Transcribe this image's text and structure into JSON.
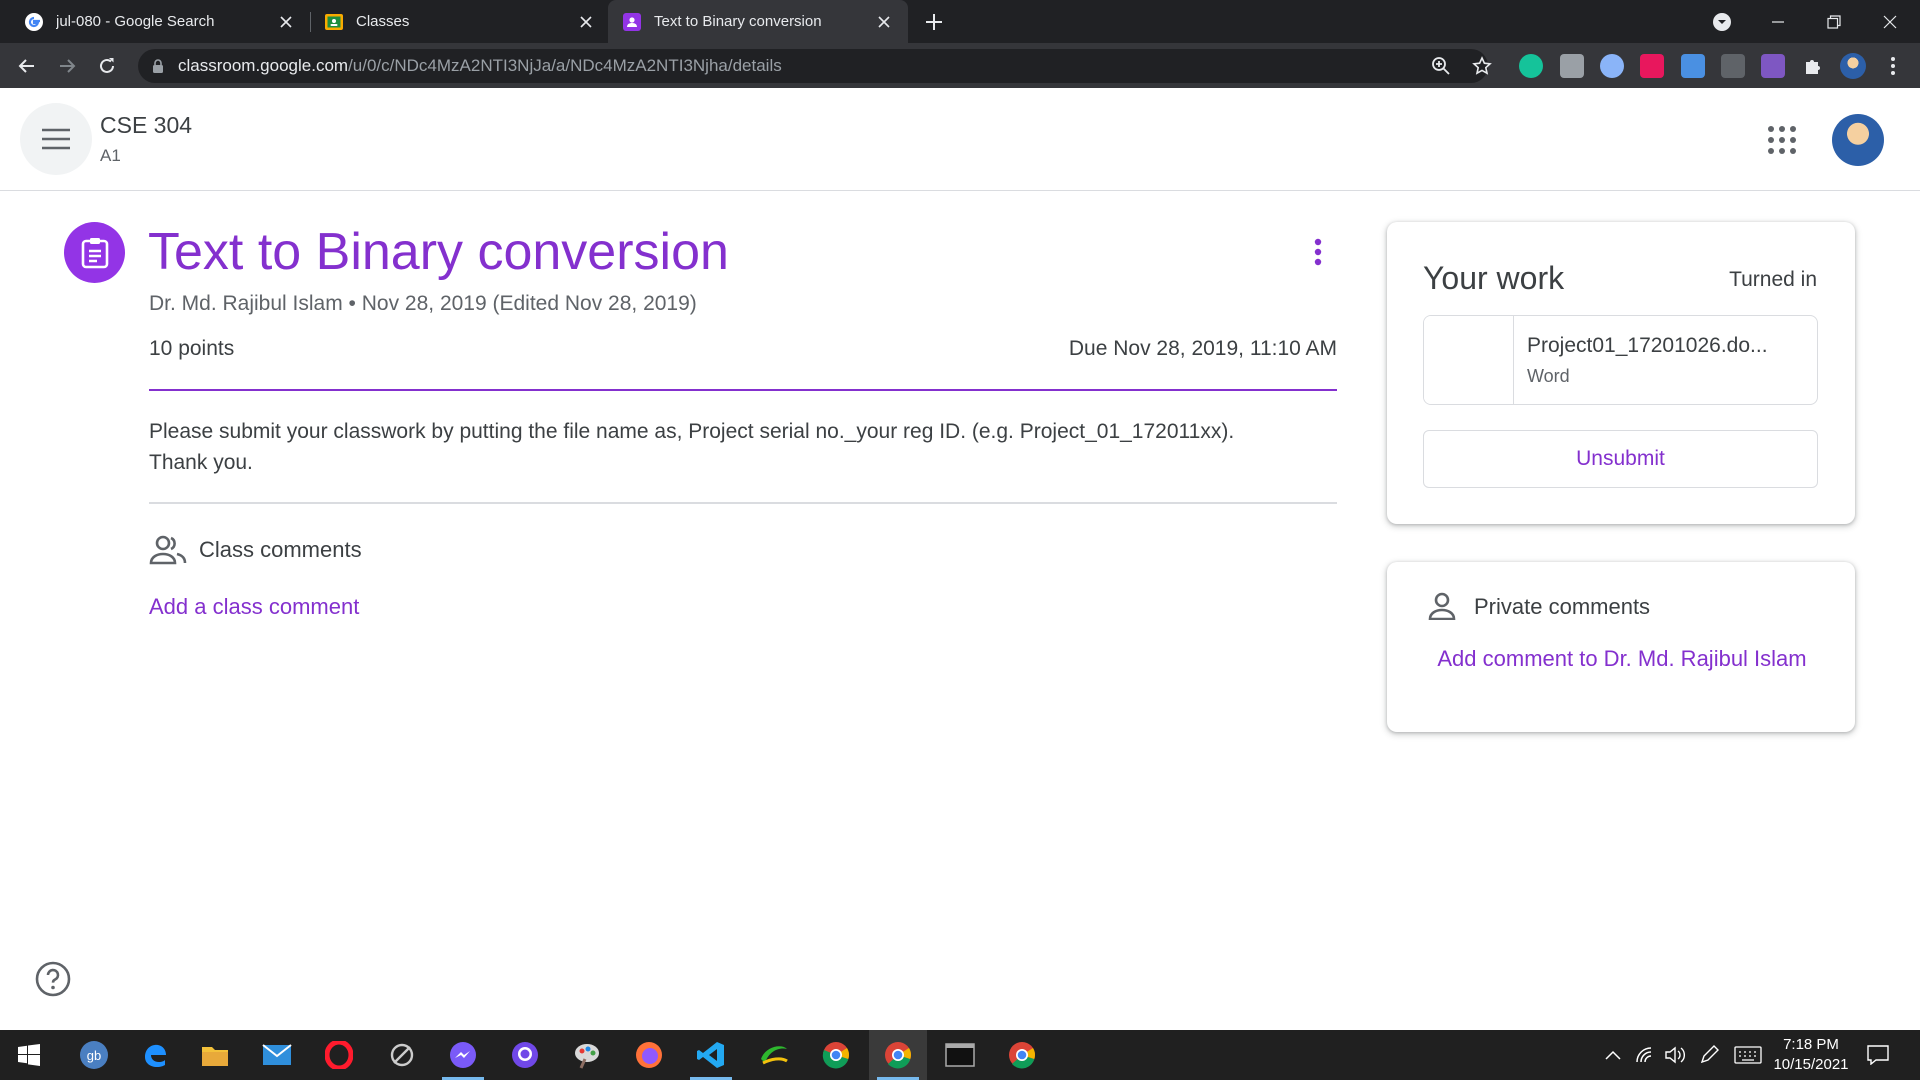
{
  "browser": {
    "tabs": [
      {
        "title": "jul-080 - Google Search",
        "icon": "google-icon"
      },
      {
        "title": "Classes",
        "icon": "classroom-icon"
      },
      {
        "title": "Text to Binary conversion",
        "icon": "classroom-assignment-icon",
        "active": true
      }
    ],
    "url_host": "classroom.google.com",
    "url_path": "/u/0/c/NDc4MzA2NTI3NjJa/a/NDc4MzA2NTI3Njha/details"
  },
  "classroom": {
    "class_name": "CSE 304",
    "section": "A1"
  },
  "assignment": {
    "title": "Text to Binary conversion",
    "meta": "Dr. Md. Rajibul Islam • Nov 28, 2019 (Edited Nov 28, 2019)",
    "points": "10 points",
    "due": "Due Nov 28, 2019, 11:10 AM",
    "description_line1": "Please submit your classwork by putting the file name as, Project serial no._your reg ID. (e.g. Project_01_172011xx).",
    "description_line2": "Thank you."
  },
  "class_comments": {
    "label": "Class comments",
    "add_label": "Add a class comment"
  },
  "your_work": {
    "title": "Your work",
    "status": "Turned in",
    "file_name": "Project01_17201026.do...",
    "file_type": "Word",
    "unsubmit_label": "Unsubmit"
  },
  "private_comments": {
    "label": "Private comments",
    "add_label": "Add comment to Dr. Md. Rajibul Islam"
  },
  "taskbar": {
    "time": "7:18 PM",
    "date": "10/15/2021"
  },
  "colors": {
    "accent": "#8430ce",
    "assignment_icon_bg": "#9334e6",
    "browser_frame": "#202124",
    "browser_toolbar": "#35363a",
    "taskbar": "#202020"
  }
}
